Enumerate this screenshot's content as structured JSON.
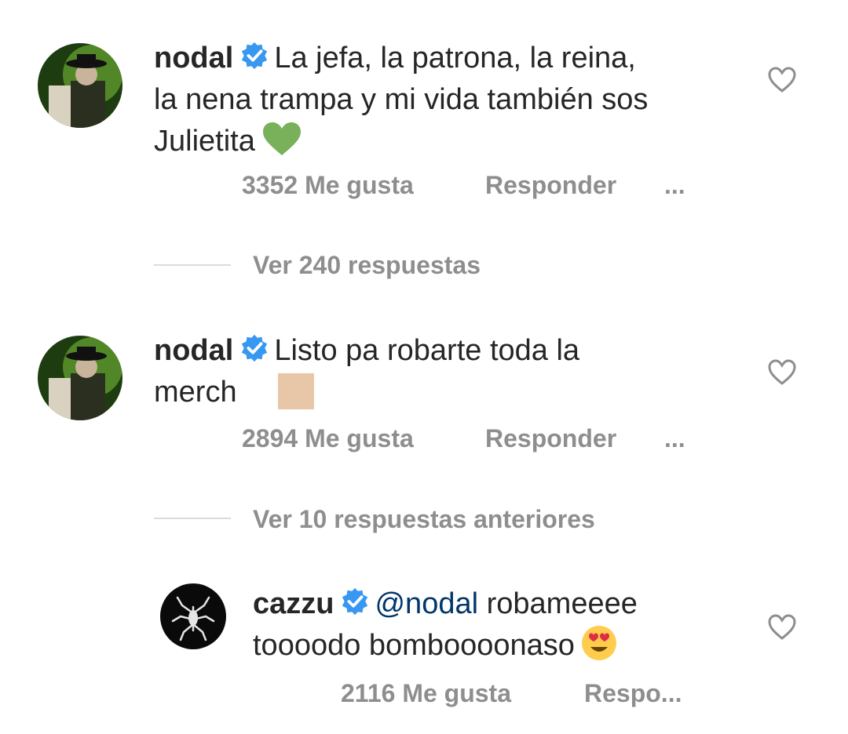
{
  "comments": [
    {
      "username": "nodal",
      "text_line1": "La jefa, la patrona, la reina,",
      "text_line2": "la nena trampa y mi vida también sos",
      "text_line3": "Julietita",
      "likes": "3352 Me gusta",
      "reply": "Responder",
      "more": "...",
      "view_replies": "Ver 240 respuestas"
    },
    {
      "username": "nodal",
      "text_line1": "Listo pa robarte toda la",
      "text_line2": "merch",
      "likes": "2894 Me gusta",
      "reply": "Responder",
      "more": "...",
      "view_replies": "Ver 10 respuestas anteriores"
    }
  ],
  "reply": {
    "username": "cazzu",
    "mention": "@nodal",
    "text_line1": "robameeee",
    "text_line2": "toooodo bomboooonaso",
    "likes": "2116 Me gusta",
    "reply": "Respo..."
  },
  "colors": {
    "verified": "#3897f0",
    "mention": "#00376b",
    "meta": "#8e8e8e",
    "green_heart": "#78b159"
  }
}
